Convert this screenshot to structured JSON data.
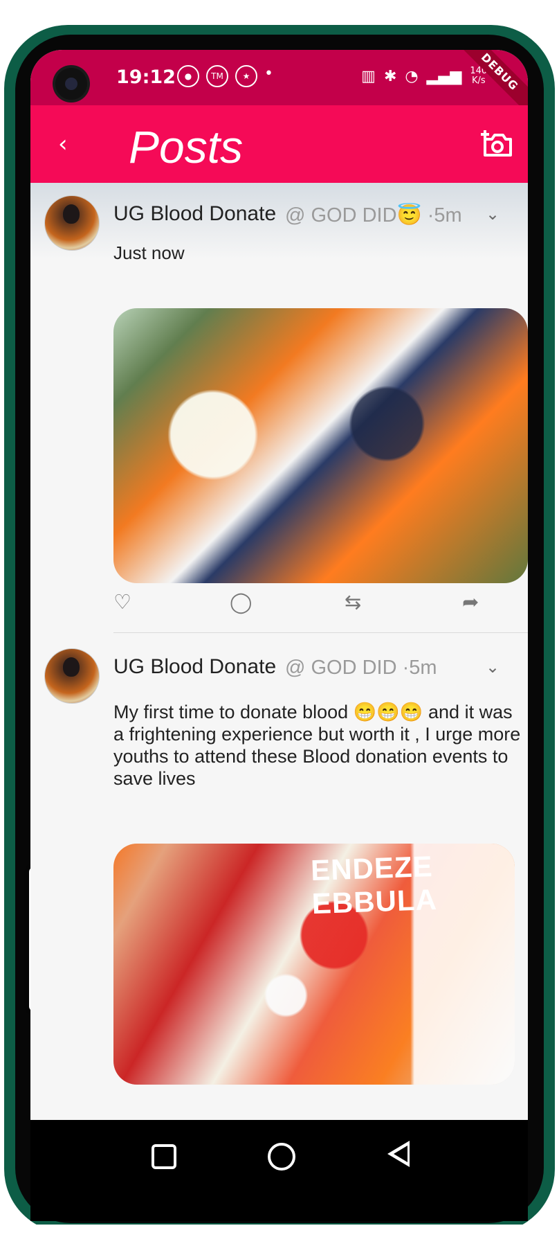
{
  "status": {
    "time": "19:12",
    "speed_top": "140",
    "speed_bottom": "K/s",
    "debug": "DEBUG"
  },
  "appbar": {
    "title": "Posts"
  },
  "posts": [
    {
      "name": "UG Blood Donate",
      "handle": "@ GOD DID😇 ·5m",
      "text": "Just now",
      "actions": {
        "like": "♡",
        "comment": "◯",
        "repost": "⇆",
        "share": "➦"
      }
    },
    {
      "name": "UG Blood Donate",
      "handle": "@ GOD DID ·5m",
      "text": "My first time to donate blood 😁😁😁 and it was a frightening experience but worth it , I urge more youths to attend these Blood donation events to save lives",
      "photo_text": "ENDEZE EBBULA",
      "actions": {
        "like": "♡",
        "comment": "◯",
        "repost": "⇆",
        "share": "➦"
      }
    }
  ]
}
